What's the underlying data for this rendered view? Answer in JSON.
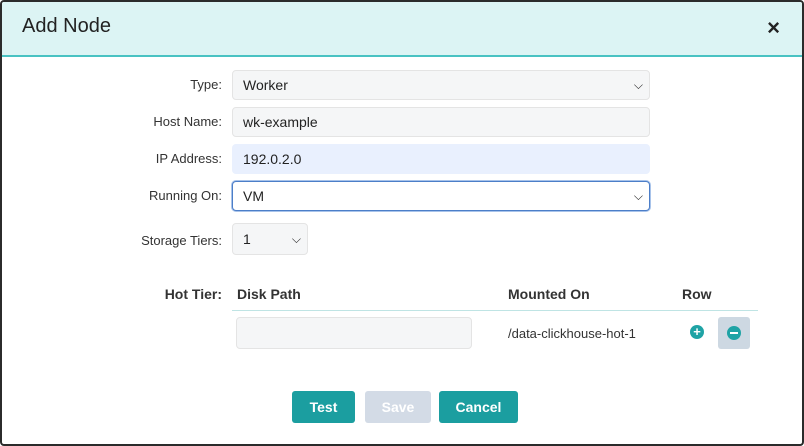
{
  "modal": {
    "title": "Add Node",
    "close_label": "×"
  },
  "form": {
    "type_label": "Type:",
    "type_value": "Worker",
    "hostname_label": "Host Name:",
    "hostname_value": "wk-example",
    "ip_label": "IP Address:",
    "ip_value": "192.0.2.0",
    "running_on_label": "Running On:",
    "running_on_value": "VM",
    "storage_tiers_label": "Storage Tiers:",
    "storage_tiers_value": "1",
    "hot_tier_label": "Hot Tier:"
  },
  "table": {
    "headers": {
      "disk_path": "Disk Path",
      "mounted_on": "Mounted On",
      "row": "Row"
    },
    "rows": [
      {
        "disk_path": "",
        "mounted_on": "/data-clickhouse-hot-1"
      }
    ]
  },
  "buttons": {
    "test": "Test",
    "save": "Save",
    "cancel": "Cancel"
  },
  "colors": {
    "accent": "#1b9ea0",
    "header_bg": "#dcf4f4",
    "disabled": "#d3dbe6"
  }
}
